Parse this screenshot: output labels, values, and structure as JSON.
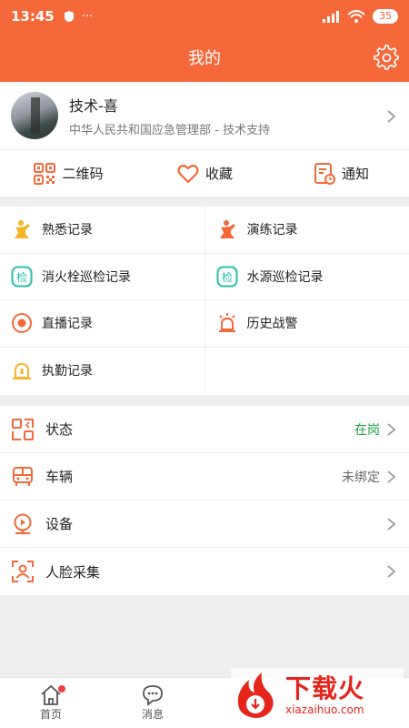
{
  "status_bar": {
    "time": "13:45",
    "battery": "35"
  },
  "header": {
    "title": "我的"
  },
  "profile": {
    "name": "技术-喜",
    "org": "中华人民共和国应急管理部 - 技术支持"
  },
  "quick_actions": [
    {
      "label": "二维码",
      "icon": "qrcode-icon"
    },
    {
      "label": "收藏",
      "icon": "heart-icon"
    },
    {
      "label": "通知",
      "icon": "notice-icon"
    }
  ],
  "records": [
    {
      "label": "熟悉记录",
      "icon": "familiar-record-icon"
    },
    {
      "label": "演练记录",
      "icon": "drill-record-icon"
    },
    {
      "label": "消火栓巡检记录",
      "icon": "hydrant-inspect-icon",
      "glyph": "检"
    },
    {
      "label": "水源巡检记录",
      "icon": "water-inspect-icon",
      "glyph": "检"
    },
    {
      "label": "直播记录",
      "icon": "live-record-icon"
    },
    {
      "label": "历史战警",
      "icon": "alarm-history-icon"
    },
    {
      "label": "执勤记录",
      "icon": "duty-record-icon"
    }
  ],
  "settings": [
    {
      "label": "状态",
      "value": "在岗",
      "icon": "status-icon"
    },
    {
      "label": "车辆",
      "value": "未绑定",
      "icon": "vehicle-icon"
    },
    {
      "label": "设备",
      "value": "",
      "icon": "device-icon"
    },
    {
      "label": "人脸采集",
      "value": "",
      "icon": "face-capture-icon"
    }
  ],
  "tabs": [
    {
      "label": "首页",
      "icon": "home-icon"
    },
    {
      "label": "消息",
      "icon": "message-icon"
    }
  ],
  "watermark": {
    "title": "下载火",
    "url": "xiazaihuo.com"
  },
  "colors": {
    "primary": "#f5683a",
    "yellow": "#f5b52a",
    "teal": "#2bbfad",
    "green": "#1aa544"
  }
}
